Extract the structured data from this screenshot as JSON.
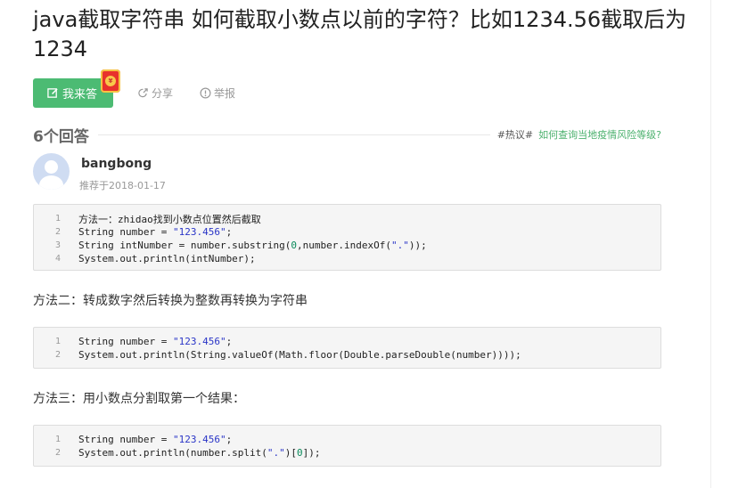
{
  "question": {
    "title": "java截取字符串 如何截取小数点以前的字符？比如1234.56截取后为1234"
  },
  "actions": {
    "answer_label": "我来答",
    "redpack_mark": "¥",
    "share_label": "分享",
    "report_label": "举报"
  },
  "answers": {
    "count_label": "6个回答",
    "hot_tag": "#热议#",
    "hot_link": "如何查询当地疫情风险等级?"
  },
  "answer": {
    "author": "bangbong",
    "meta": "推荐于2018-01-17",
    "code_blocks": [
      {
        "lines": [
          {
            "n": "1",
            "parts": [
              {
                "t": "方法一：zhidao找到小数点位置然后截取",
                "c": ""
              }
            ]
          },
          {
            "n": "2",
            "parts": [
              {
                "t": "String number = ",
                "c": ""
              },
              {
                "t": "\"123.456\"",
                "c": "str"
              },
              {
                "t": ";",
                "c": ""
              }
            ]
          },
          {
            "n": "3",
            "parts": [
              {
                "t": "String intNumber = number.substring(",
                "c": ""
              },
              {
                "t": "0",
                "c": "num"
              },
              {
                "t": ",number.indexOf(",
                "c": ""
              },
              {
                "t": "\".\"",
                "c": "str"
              },
              {
                "t": "));",
                "c": ""
              }
            ]
          },
          {
            "n": "4",
            "parts": [
              {
                "t": "System.out.println(intNumber);",
                "c": ""
              }
            ]
          }
        ]
      },
      {
        "lines": [
          {
            "n": "1",
            "parts": [
              {
                "t": "String number = ",
                "c": ""
              },
              {
                "t": "\"123.456\"",
                "c": "str"
              },
              {
                "t": ";",
                "c": ""
              }
            ]
          },
          {
            "n": "2",
            "parts": [
              {
                "t": "System.out.println(String.valueOf(Math.floor(Double.parseDouble(number))));",
                "c": ""
              }
            ]
          }
        ]
      },
      {
        "lines": [
          {
            "n": "1",
            "parts": [
              {
                "t": "String number = ",
                "c": ""
              },
              {
                "t": "\"123.456\"",
                "c": "str"
              },
              {
                "t": ";",
                "c": ""
              }
            ]
          },
          {
            "n": "2",
            "parts": [
              {
                "t": "System.out.println(number.split(",
                "c": ""
              },
              {
                "t": "\".\"",
                "c": "str"
              },
              {
                "t": ")[",
                "c": ""
              },
              {
                "t": "0",
                "c": "num"
              },
              {
                "t": "]);",
                "c": ""
              }
            ]
          }
        ]
      }
    ],
    "paragraphs": [
      "方法二：转成数字然后转换为整数再转换为字符串",
      "方法三：用小数点分割取第一个结果："
    ]
  }
}
